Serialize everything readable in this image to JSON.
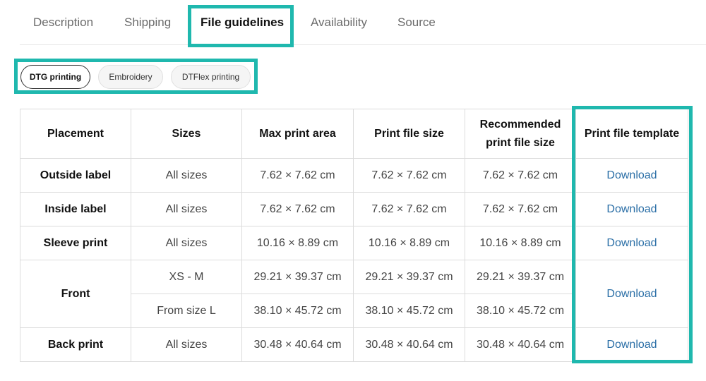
{
  "tabs": [
    {
      "label": "Description",
      "active": false
    },
    {
      "label": "Shipping",
      "active": false
    },
    {
      "label": "File guidelines",
      "active": true
    },
    {
      "label": "Availability",
      "active": false
    },
    {
      "label": "Source",
      "active": false
    }
  ],
  "methods": [
    {
      "label": "DTG printing",
      "active": true
    },
    {
      "label": "Embroidery",
      "active": false
    },
    {
      "label": "DTFlex printing",
      "active": false
    }
  ],
  "table": {
    "headers": [
      "Placement",
      "Sizes",
      "Max print area",
      "Print file size",
      "Recommended print file size",
      "Print file template"
    ],
    "rows": [
      {
        "placement": "Outside label",
        "sizes": "All sizes",
        "max_area": "7.62 × 7.62 cm",
        "file_size": "7.62 × 7.62 cm",
        "recommended": "7.62 × 7.62 cm",
        "template": "Download"
      },
      {
        "placement": "Inside label",
        "sizes": "All sizes",
        "max_area": "7.62 × 7.62 cm",
        "file_size": "7.62 × 7.62 cm",
        "recommended": "7.62 × 7.62 cm",
        "template": "Download"
      },
      {
        "placement": "Sleeve print",
        "sizes": "All sizes",
        "max_area": "10.16 × 8.89 cm",
        "file_size": "10.16 × 8.89 cm",
        "recommended": "10.16 × 8.89 cm",
        "template": "Download"
      },
      {
        "placement": "Front",
        "sizes": "XS - M",
        "max_area": "29.21 × 39.37 cm",
        "file_size": "29.21 × 39.37 cm",
        "recommended": "29.21 × 39.37 cm",
        "template": "Download"
      },
      {
        "placement": "",
        "sizes": "From size L",
        "max_area": "38.10 × 45.72 cm",
        "file_size": "38.10 × 45.72 cm",
        "recommended": "38.10 × 45.72 cm",
        "template": ""
      },
      {
        "placement": "Back print",
        "sizes": "All sizes",
        "max_area": "30.48 × 40.64 cm",
        "file_size": "30.48 × 40.64 cm",
        "recommended": "30.48 × 40.64 cm",
        "template": "Download"
      }
    ]
  },
  "colors": {
    "highlight": "#1fb8ae",
    "link": "#2a6ea6"
  }
}
